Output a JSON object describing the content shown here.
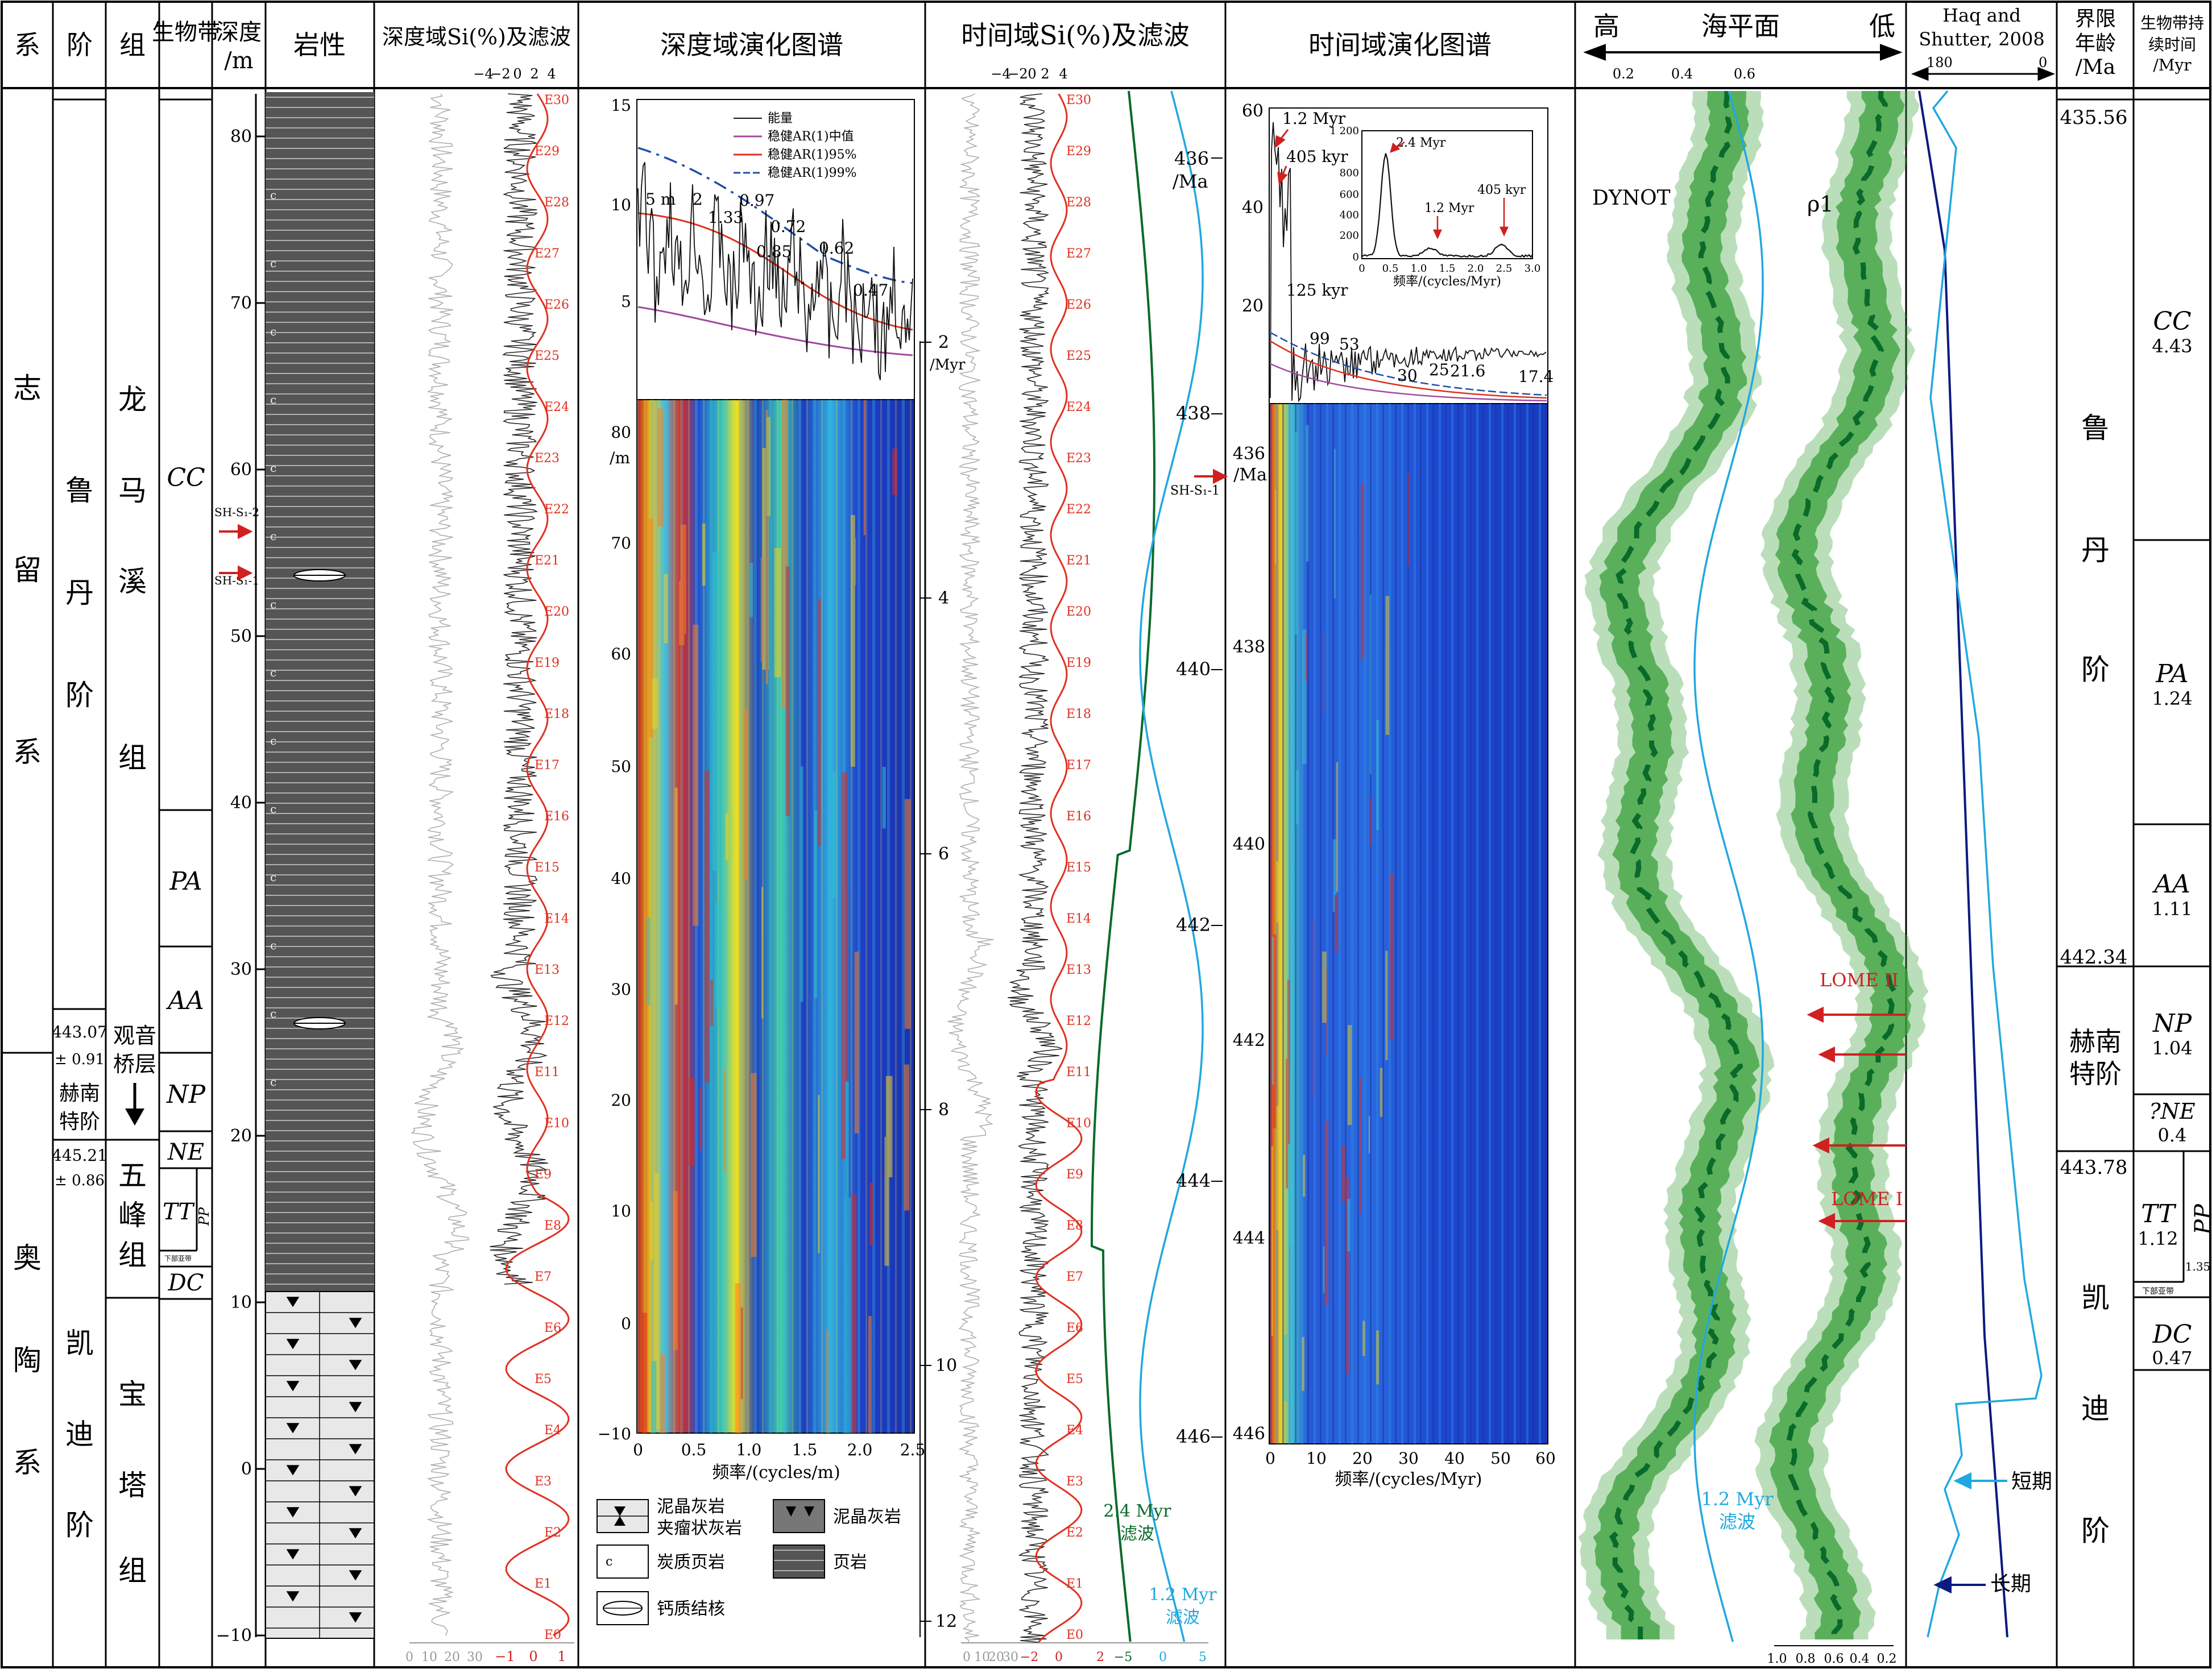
{
  "header": {
    "xi": "系",
    "jie": "阶",
    "zu": "组",
    "biozone": "生物带",
    "depth": "深度",
    "depth_unit": "/m",
    "lith": "岩性",
    "si_depth": "深度域Si(%)及滤波",
    "evo_depth": "深度域演化图谱",
    "si_time": "时间域Si(%)及滤波",
    "evo_time": "时间域演化图谱",
    "sea_level": "海平面",
    "high": "高",
    "low": "低",
    "haq_1": "Haq and",
    "haq_2": "Shutter, 2008",
    "age_1": "界限",
    "age_2": "年龄",
    "age_3": "/Ma",
    "dur_1": "生物带持",
    "dur_2": "续时间",
    "dur_3": "/Myr"
  },
  "systems": [
    "志留系",
    "奥陶系"
  ],
  "stages_left": {
    "rhuddanian": "鲁丹阶",
    "hirnantian_1": "赫南",
    "hirnantian_2": "特阶",
    "katian": "凯迪阶"
  },
  "formations": {
    "longmaxi": "龙马溪组",
    "guanyinqiao_1": "观音",
    "guanyinqiao_2": "桥层",
    "wufeng": "五峰组",
    "baota": "宝塔组"
  },
  "ages_left": {
    "a1": "443.07",
    "a1e": "± 0.91",
    "a2": "445.21",
    "a2e": "± 0.86"
  },
  "biozones": {
    "cc": "CC",
    "pa": "PA",
    "aa": "AA",
    "np": "NP",
    "ne": "NE",
    "tt": "TT",
    "pp": "PP",
    "sub": "下部亚带",
    "dc": "DC"
  },
  "depth_ticks": [
    "80",
    "70",
    "60",
    "50",
    "40",
    "30",
    "20",
    "10",
    "0",
    "−10"
  ],
  "samples": {
    "s2": "SH-S₁-2",
    "s1": "SH-S₁-1",
    "t1": "SH-S₁-1"
  },
  "si_depth_axes": {
    "top": [
      "−4",
      "−2",
      "0",
      "2",
      "4"
    ],
    "bottom_gray": [
      "0",
      "10",
      "20",
      "30"
    ],
    "bottom_red": [
      "−1",
      "0",
      "1"
    ]
  },
  "e_cycles": [
    "E30",
    "E29",
    "E28",
    "E27",
    "E26",
    "E25",
    "E24",
    "E23",
    "E22",
    "E21",
    "E20",
    "E19",
    "E18",
    "E17",
    "E16",
    "E15",
    "E14",
    "E13",
    "E12",
    "E11",
    "E10",
    "E9",
    "E8",
    "E7",
    "E6",
    "E5",
    "E4",
    "E3",
    "E2",
    "E1",
    "E0"
  ],
  "spectrum_depth": {
    "legend": [
      "能量",
      "稳健AR(1)中值",
      "稳健AR(1)95%",
      "稳健AR(1)99%"
    ],
    "peaks": [
      "5 m",
      "2",
      "1.33",
      "0.97",
      "0.85",
      "0.72",
      "0.62",
      "0.47"
    ],
    "yticks": [
      "15",
      "10",
      "5"
    ]
  },
  "evo_depth_axes": {
    "yticks": [
      "80",
      "/m",
      "70",
      "60",
      "50",
      "40",
      "30",
      "20",
      "10",
      "0",
      "−10"
    ],
    "xticks": [
      "0",
      "0.5",
      "1.0",
      "1.5",
      "2.0",
      "2.5"
    ],
    "xlabel": "频率/(cycles/m)"
  },
  "myr_ticks": [
    "2",
    "/Myr",
    "4",
    "6",
    "8",
    "10",
    "12"
  ],
  "legend_lith": {
    "l1a": "泥晶灰岩",
    "l1b": "夹瘤状灰岩",
    "l2": "泥晶灰岩",
    "l3": "炭质页岩",
    "l4": "页岩",
    "l5": "钙质结核"
  },
  "si_time_axes": {
    "top": [
      "−4",
      "−2",
      "0",
      "2",
      "4"
    ],
    "bottom_gray": [
      "0",
      "10",
      "20",
      "30"
    ],
    "bottom_red": [
      "−2",
      "0",
      "2"
    ],
    "bottom_green": [
      "−5",
      "0",
      "5"
    ]
  },
  "filters": {
    "f24a": "2.4 Myr",
    "f24b": "滤波",
    "f12a": "1.2 Myr",
    "f12b": "滤波"
  },
  "ma_ticks": {
    "t436": "436",
    "ma": "/Ma",
    "t438": "438",
    "t440": "440",
    "t442": "442",
    "t444": "444",
    "t446": "446"
  },
  "spectrum_time": {
    "yticks": [
      "60",
      "40",
      "20"
    ],
    "peaks": [
      "1.2 Myr",
      "405 kyr",
      "125 kyr",
      "99",
      "53",
      "30",
      "25",
      "21.6",
      "17.4"
    ],
    "inset_yticks": [
      "1 200",
      "800",
      "600",
      "400",
      "200",
      "0"
    ],
    "inset_xticks": [
      "0",
      "0.5",
      "1.0",
      "1.5",
      "2.0",
      "2.5",
      "3.0"
    ],
    "inset_xlabel": "频率/(cycles/Myr)",
    "inset_peaks": [
      "2.4 Myr",
      "1.2 Myr",
      "405 kyr"
    ]
  },
  "evo_time_axes": {
    "yticks": [
      "436",
      "/Ma",
      "438",
      "440",
      "442",
      "444",
      "446"
    ],
    "xticks": [
      "0",
      "10",
      "20",
      "30",
      "40",
      "50",
      "60"
    ],
    "xlabel": "频率/(cycles/Myr)"
  },
  "sea_level_panel": {
    "top_ticks": [
      "0.2",
      "0.4",
      "0.6"
    ],
    "bottom_ticks": [
      "1.0",
      "0.8",
      "0.6",
      "0.4",
      "0.2"
    ],
    "dynot": "DYNOT",
    "rho": "ρ1",
    "filter_a": "1.2 Myr",
    "filter_b": "滤波",
    "lome2": "LOME II",
    "lome1": "LOME I"
  },
  "haq_panel": {
    "t180": "180",
    "t0": "0",
    "short": "短期",
    "long": "长期"
  },
  "ages_right": {
    "a1": "435.56",
    "a2": "442.34",
    "a3": "443.78"
  },
  "stages_right": {
    "r1": "鲁",
    "r2": "丹",
    "r3": "阶",
    "h1": "赫南",
    "h2": "特阶",
    "k1": "凯",
    "k2": "迪",
    "k3": "阶"
  },
  "durations": {
    "cc": "CC",
    "ccv": "4.43",
    "pa": "PA",
    "pav": "1.24",
    "aa": "AA",
    "aav": "1.11",
    "np": "NP",
    "npv": "1.04",
    "ne": "?NE",
    "nev": "0.4",
    "tt": "TT",
    "ttv": "1.12",
    "pp": "PP",
    "ppv": "1.35",
    "sub": "下部亚带",
    "dc": "DC",
    "dcv": "0.47"
  },
  "colors": {
    "red": "#e03020",
    "blue_ar": "#1f4fa8",
    "purple": "#a04aa0",
    "green_dark": "#0a6a2a",
    "cyan": "#20a8e0",
    "navy": "#0a1a80",
    "band_green": "#3aa03a"
  }
}
